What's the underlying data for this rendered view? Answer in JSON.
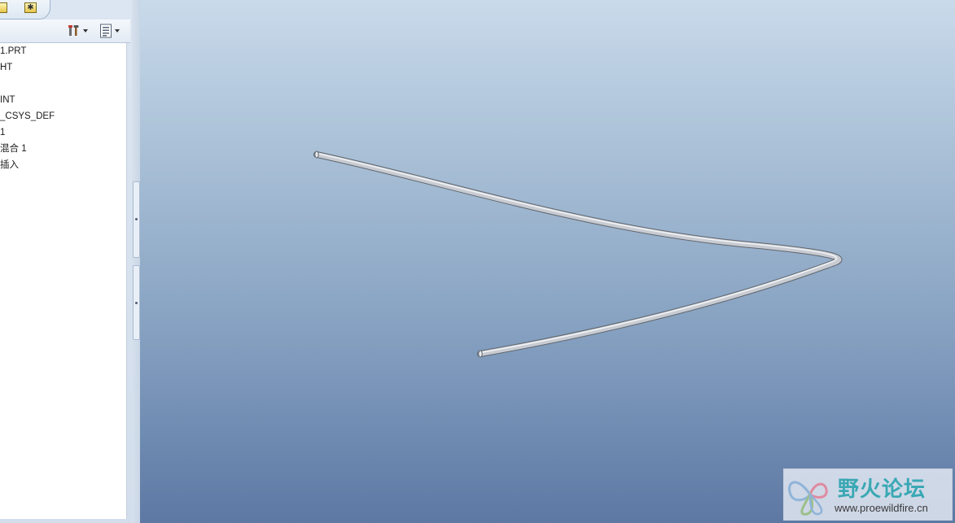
{
  "model_tree": {
    "items": [
      {
        "label": "1.PRT"
      },
      {
        "label": "HT"
      },
      {
        "label": ""
      },
      {
        "label": "INT"
      },
      {
        "label": "_CSYS_DEF"
      },
      {
        "label": "1"
      },
      {
        "label": "混合 1"
      },
      {
        "label": "插入"
      }
    ],
    "settings_icon": "tools-icon",
    "show_icon": "list-icon"
  },
  "tabs": {
    "star_glyph": "✱"
  },
  "watermark": {
    "title": "野火论坛",
    "url": "www.proewildfire.cn"
  },
  "colors": {
    "tube": "#c8ccd2",
    "viewport_top": "#c9daea",
    "viewport_bottom": "#5d78a3"
  }
}
